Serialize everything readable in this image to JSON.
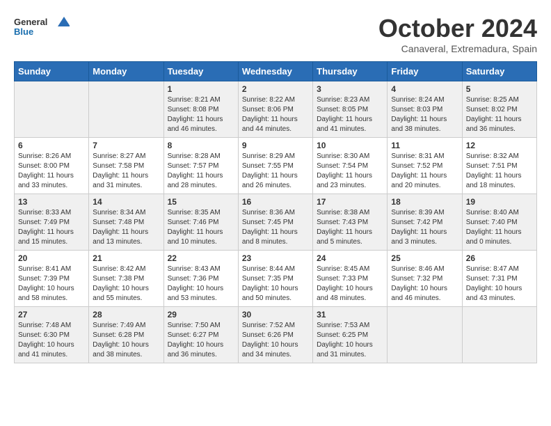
{
  "header": {
    "logo_general": "General",
    "logo_blue": "Blue",
    "month_title": "October 2024",
    "location": "Canaveral, Extremadura, Spain"
  },
  "days_of_week": [
    "Sunday",
    "Monday",
    "Tuesday",
    "Wednesday",
    "Thursday",
    "Friday",
    "Saturday"
  ],
  "weeks": [
    [
      {
        "day": "",
        "info": ""
      },
      {
        "day": "",
        "info": ""
      },
      {
        "day": "1",
        "info": "Sunrise: 8:21 AM\nSunset: 8:08 PM\nDaylight: 11 hours and 46 minutes."
      },
      {
        "day": "2",
        "info": "Sunrise: 8:22 AM\nSunset: 8:06 PM\nDaylight: 11 hours and 44 minutes."
      },
      {
        "day": "3",
        "info": "Sunrise: 8:23 AM\nSunset: 8:05 PM\nDaylight: 11 hours and 41 minutes."
      },
      {
        "day": "4",
        "info": "Sunrise: 8:24 AM\nSunset: 8:03 PM\nDaylight: 11 hours and 38 minutes."
      },
      {
        "day": "5",
        "info": "Sunrise: 8:25 AM\nSunset: 8:02 PM\nDaylight: 11 hours and 36 minutes."
      }
    ],
    [
      {
        "day": "6",
        "info": "Sunrise: 8:26 AM\nSunset: 8:00 PM\nDaylight: 11 hours and 33 minutes."
      },
      {
        "day": "7",
        "info": "Sunrise: 8:27 AM\nSunset: 7:58 PM\nDaylight: 11 hours and 31 minutes."
      },
      {
        "day": "8",
        "info": "Sunrise: 8:28 AM\nSunset: 7:57 PM\nDaylight: 11 hours and 28 minutes."
      },
      {
        "day": "9",
        "info": "Sunrise: 8:29 AM\nSunset: 7:55 PM\nDaylight: 11 hours and 26 minutes."
      },
      {
        "day": "10",
        "info": "Sunrise: 8:30 AM\nSunset: 7:54 PM\nDaylight: 11 hours and 23 minutes."
      },
      {
        "day": "11",
        "info": "Sunrise: 8:31 AM\nSunset: 7:52 PM\nDaylight: 11 hours and 20 minutes."
      },
      {
        "day": "12",
        "info": "Sunrise: 8:32 AM\nSunset: 7:51 PM\nDaylight: 11 hours and 18 minutes."
      }
    ],
    [
      {
        "day": "13",
        "info": "Sunrise: 8:33 AM\nSunset: 7:49 PM\nDaylight: 11 hours and 15 minutes."
      },
      {
        "day": "14",
        "info": "Sunrise: 8:34 AM\nSunset: 7:48 PM\nDaylight: 11 hours and 13 minutes."
      },
      {
        "day": "15",
        "info": "Sunrise: 8:35 AM\nSunset: 7:46 PM\nDaylight: 11 hours and 10 minutes."
      },
      {
        "day": "16",
        "info": "Sunrise: 8:36 AM\nSunset: 7:45 PM\nDaylight: 11 hours and 8 minutes."
      },
      {
        "day": "17",
        "info": "Sunrise: 8:38 AM\nSunset: 7:43 PM\nDaylight: 11 hours and 5 minutes."
      },
      {
        "day": "18",
        "info": "Sunrise: 8:39 AM\nSunset: 7:42 PM\nDaylight: 11 hours and 3 minutes."
      },
      {
        "day": "19",
        "info": "Sunrise: 8:40 AM\nSunset: 7:40 PM\nDaylight: 11 hours and 0 minutes."
      }
    ],
    [
      {
        "day": "20",
        "info": "Sunrise: 8:41 AM\nSunset: 7:39 PM\nDaylight: 10 hours and 58 minutes."
      },
      {
        "day": "21",
        "info": "Sunrise: 8:42 AM\nSunset: 7:38 PM\nDaylight: 10 hours and 55 minutes."
      },
      {
        "day": "22",
        "info": "Sunrise: 8:43 AM\nSunset: 7:36 PM\nDaylight: 10 hours and 53 minutes."
      },
      {
        "day": "23",
        "info": "Sunrise: 8:44 AM\nSunset: 7:35 PM\nDaylight: 10 hours and 50 minutes."
      },
      {
        "day": "24",
        "info": "Sunrise: 8:45 AM\nSunset: 7:33 PM\nDaylight: 10 hours and 48 minutes."
      },
      {
        "day": "25",
        "info": "Sunrise: 8:46 AM\nSunset: 7:32 PM\nDaylight: 10 hours and 46 minutes."
      },
      {
        "day": "26",
        "info": "Sunrise: 8:47 AM\nSunset: 7:31 PM\nDaylight: 10 hours and 43 minutes."
      }
    ],
    [
      {
        "day": "27",
        "info": "Sunrise: 7:48 AM\nSunset: 6:30 PM\nDaylight: 10 hours and 41 minutes."
      },
      {
        "day": "28",
        "info": "Sunrise: 7:49 AM\nSunset: 6:28 PM\nDaylight: 10 hours and 38 minutes."
      },
      {
        "day": "29",
        "info": "Sunrise: 7:50 AM\nSunset: 6:27 PM\nDaylight: 10 hours and 36 minutes."
      },
      {
        "day": "30",
        "info": "Sunrise: 7:52 AM\nSunset: 6:26 PM\nDaylight: 10 hours and 34 minutes."
      },
      {
        "day": "31",
        "info": "Sunrise: 7:53 AM\nSunset: 6:25 PM\nDaylight: 10 hours and 31 minutes."
      },
      {
        "day": "",
        "info": ""
      },
      {
        "day": "",
        "info": ""
      }
    ]
  ]
}
